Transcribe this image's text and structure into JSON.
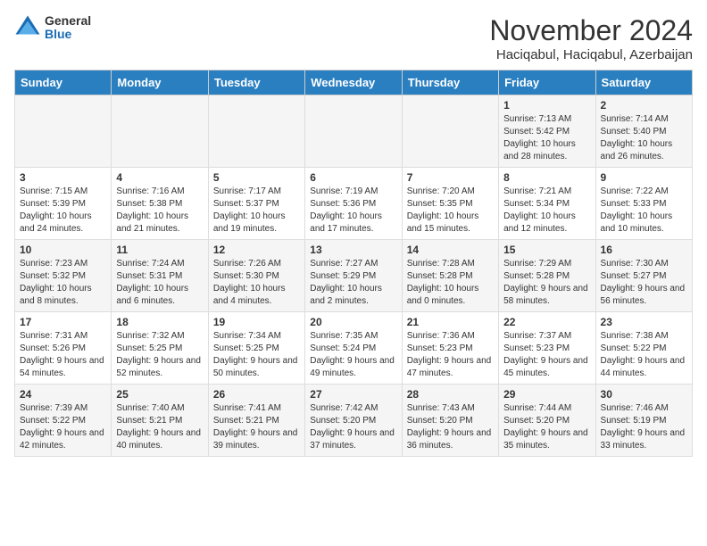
{
  "header": {
    "logo_general": "General",
    "logo_blue": "Blue",
    "month_title": "November 2024",
    "location": "Haciqabul, Haciqabul, Azerbaijan"
  },
  "weekdays": [
    "Sunday",
    "Monday",
    "Tuesday",
    "Wednesday",
    "Thursday",
    "Friday",
    "Saturday"
  ],
  "weeks": [
    [
      {
        "day": "",
        "info": ""
      },
      {
        "day": "",
        "info": ""
      },
      {
        "day": "",
        "info": ""
      },
      {
        "day": "",
        "info": ""
      },
      {
        "day": "",
        "info": ""
      },
      {
        "day": "1",
        "info": "Sunrise: 7:13 AM\nSunset: 5:42 PM\nDaylight: 10 hours and 28 minutes."
      },
      {
        "day": "2",
        "info": "Sunrise: 7:14 AM\nSunset: 5:40 PM\nDaylight: 10 hours and 26 minutes."
      }
    ],
    [
      {
        "day": "3",
        "info": "Sunrise: 7:15 AM\nSunset: 5:39 PM\nDaylight: 10 hours and 24 minutes."
      },
      {
        "day": "4",
        "info": "Sunrise: 7:16 AM\nSunset: 5:38 PM\nDaylight: 10 hours and 21 minutes."
      },
      {
        "day": "5",
        "info": "Sunrise: 7:17 AM\nSunset: 5:37 PM\nDaylight: 10 hours and 19 minutes."
      },
      {
        "day": "6",
        "info": "Sunrise: 7:19 AM\nSunset: 5:36 PM\nDaylight: 10 hours and 17 minutes."
      },
      {
        "day": "7",
        "info": "Sunrise: 7:20 AM\nSunset: 5:35 PM\nDaylight: 10 hours and 15 minutes."
      },
      {
        "day": "8",
        "info": "Sunrise: 7:21 AM\nSunset: 5:34 PM\nDaylight: 10 hours and 12 minutes."
      },
      {
        "day": "9",
        "info": "Sunrise: 7:22 AM\nSunset: 5:33 PM\nDaylight: 10 hours and 10 minutes."
      }
    ],
    [
      {
        "day": "10",
        "info": "Sunrise: 7:23 AM\nSunset: 5:32 PM\nDaylight: 10 hours and 8 minutes."
      },
      {
        "day": "11",
        "info": "Sunrise: 7:24 AM\nSunset: 5:31 PM\nDaylight: 10 hours and 6 minutes."
      },
      {
        "day": "12",
        "info": "Sunrise: 7:26 AM\nSunset: 5:30 PM\nDaylight: 10 hours and 4 minutes."
      },
      {
        "day": "13",
        "info": "Sunrise: 7:27 AM\nSunset: 5:29 PM\nDaylight: 10 hours and 2 minutes."
      },
      {
        "day": "14",
        "info": "Sunrise: 7:28 AM\nSunset: 5:28 PM\nDaylight: 10 hours and 0 minutes."
      },
      {
        "day": "15",
        "info": "Sunrise: 7:29 AM\nSunset: 5:28 PM\nDaylight: 9 hours and 58 minutes."
      },
      {
        "day": "16",
        "info": "Sunrise: 7:30 AM\nSunset: 5:27 PM\nDaylight: 9 hours and 56 minutes."
      }
    ],
    [
      {
        "day": "17",
        "info": "Sunrise: 7:31 AM\nSunset: 5:26 PM\nDaylight: 9 hours and 54 minutes."
      },
      {
        "day": "18",
        "info": "Sunrise: 7:32 AM\nSunset: 5:25 PM\nDaylight: 9 hours and 52 minutes."
      },
      {
        "day": "19",
        "info": "Sunrise: 7:34 AM\nSunset: 5:25 PM\nDaylight: 9 hours and 50 minutes."
      },
      {
        "day": "20",
        "info": "Sunrise: 7:35 AM\nSunset: 5:24 PM\nDaylight: 9 hours and 49 minutes."
      },
      {
        "day": "21",
        "info": "Sunrise: 7:36 AM\nSunset: 5:23 PM\nDaylight: 9 hours and 47 minutes."
      },
      {
        "day": "22",
        "info": "Sunrise: 7:37 AM\nSunset: 5:23 PM\nDaylight: 9 hours and 45 minutes."
      },
      {
        "day": "23",
        "info": "Sunrise: 7:38 AM\nSunset: 5:22 PM\nDaylight: 9 hours and 44 minutes."
      }
    ],
    [
      {
        "day": "24",
        "info": "Sunrise: 7:39 AM\nSunset: 5:22 PM\nDaylight: 9 hours and 42 minutes."
      },
      {
        "day": "25",
        "info": "Sunrise: 7:40 AM\nSunset: 5:21 PM\nDaylight: 9 hours and 40 minutes."
      },
      {
        "day": "26",
        "info": "Sunrise: 7:41 AM\nSunset: 5:21 PM\nDaylight: 9 hours and 39 minutes."
      },
      {
        "day": "27",
        "info": "Sunrise: 7:42 AM\nSunset: 5:20 PM\nDaylight: 9 hours and 37 minutes."
      },
      {
        "day": "28",
        "info": "Sunrise: 7:43 AM\nSunset: 5:20 PM\nDaylight: 9 hours and 36 minutes."
      },
      {
        "day": "29",
        "info": "Sunrise: 7:44 AM\nSunset: 5:20 PM\nDaylight: 9 hours and 35 minutes."
      },
      {
        "day": "30",
        "info": "Sunrise: 7:46 AM\nSunset: 5:19 PM\nDaylight: 9 hours and 33 minutes."
      }
    ]
  ]
}
